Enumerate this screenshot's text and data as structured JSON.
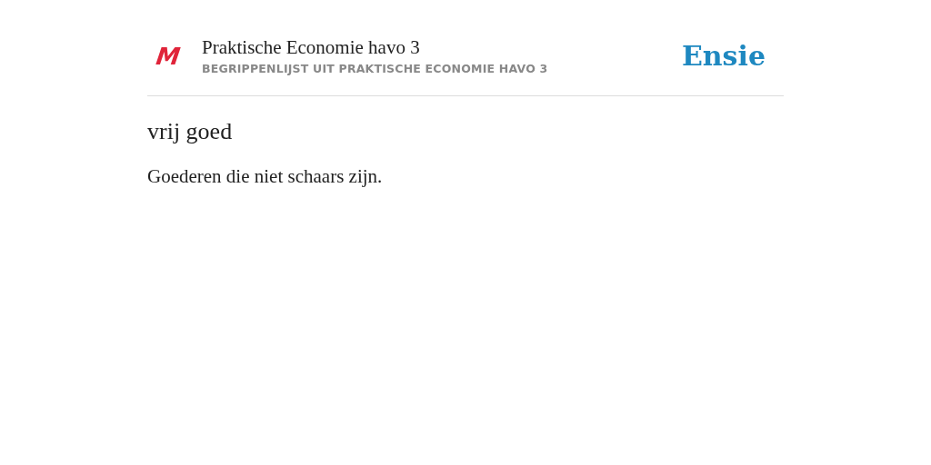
{
  "header": {
    "logo": "M",
    "title": "Praktische Economie havo 3",
    "subtitle": "BEGRIPPENLIJST UIT PRAKTISCHE ECONOMIE HAVO 3",
    "brand": "Ensie"
  },
  "term": "vrij goed",
  "definition": "Goederen die niet schaars zijn."
}
